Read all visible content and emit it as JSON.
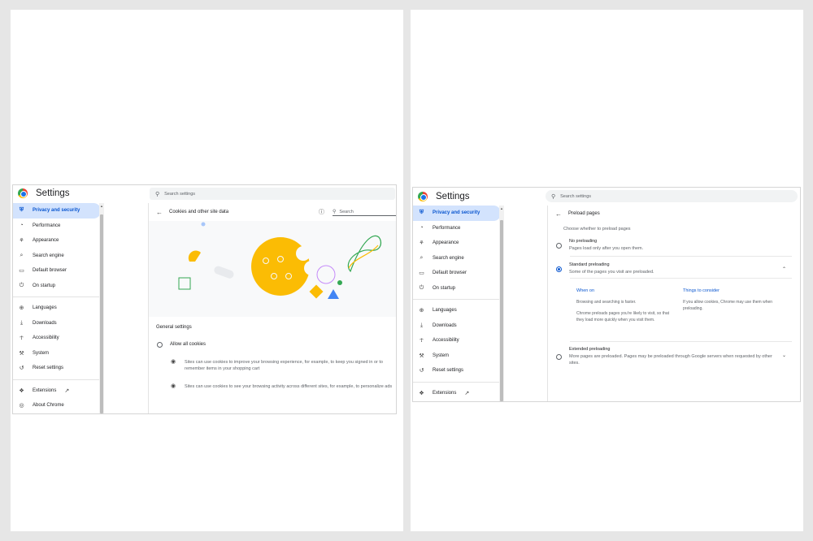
{
  "left": {
    "app_title": "Settings",
    "search_placeholder": "Search settings",
    "sidebar": [
      {
        "label": "Privacy and security",
        "icon": "shield-icon",
        "active": true
      },
      {
        "label": "Performance",
        "icon": "gauge-icon"
      },
      {
        "label": "Appearance",
        "icon": "palette-icon"
      },
      {
        "label": "Search engine",
        "icon": "search-icon"
      },
      {
        "label": "Default browser",
        "icon": "browser-icon"
      },
      {
        "label": "On startup",
        "icon": "power-icon"
      },
      {
        "label": "Languages",
        "icon": "globe-icon"
      },
      {
        "label": "Downloads",
        "icon": "download-icon"
      },
      {
        "label": "Accessibility",
        "icon": "accessibility-icon"
      },
      {
        "label": "System",
        "icon": "wrench-icon"
      },
      {
        "label": "Reset settings",
        "icon": "history-icon"
      },
      {
        "label": "Extensions",
        "icon": "puzzle-icon"
      },
      {
        "label": "About Chrome",
        "icon": "chrome-icon"
      }
    ],
    "page_title": "Cookies and other site data",
    "inner_search_placeholder": "Search",
    "general_settings": "General settings",
    "allow_all": "Allow all cookies",
    "bullet1": "Sites can use cookies to improve your browsing experience, for example, to keep you signed in or to remember items in your shopping cart",
    "bullet2": "Sites can use cookies to see your browsing activity across different sites, for example, to personalize ads",
    "colors": {
      "accent": "#0b57d0",
      "cookie": "#fbbc04",
      "green": "#34a853",
      "blue": "#4285f4"
    }
  },
  "right": {
    "app_title": "Settings",
    "search_placeholder": "Search settings",
    "sidebar": [
      {
        "label": "Privacy and security",
        "icon": "shield-icon",
        "active": true
      },
      {
        "label": "Performance",
        "icon": "gauge-icon"
      },
      {
        "label": "Appearance",
        "icon": "palette-icon"
      },
      {
        "label": "Search engine",
        "icon": "search-icon"
      },
      {
        "label": "Default browser",
        "icon": "browser-icon"
      },
      {
        "label": "On startup",
        "icon": "power-icon"
      },
      {
        "label": "Languages",
        "icon": "globe-icon"
      },
      {
        "label": "Downloads",
        "icon": "download-icon"
      },
      {
        "label": "Accessibility",
        "icon": "accessibility-icon"
      },
      {
        "label": "System",
        "icon": "wrench-icon"
      },
      {
        "label": "Reset settings",
        "icon": "history-icon"
      },
      {
        "label": "Extensions",
        "icon": "puzzle-icon"
      }
    ],
    "page_title": "Preload pages",
    "choose_label": "Choose whether to preload pages",
    "options": [
      {
        "title": "No preloading",
        "desc": "Pages load only after you open them.",
        "checked": false
      },
      {
        "title": "Standard preloading",
        "desc": "Some of the pages you visit are preloaded.",
        "checked": true
      },
      {
        "title": "Extended preloading",
        "desc": "More pages are preloaded. Pages may be preloaded through Google servers when requested by other sites.",
        "checked": false
      }
    ],
    "when_on_title": "When on",
    "when_on_1": "Browsing and searching is faster.",
    "when_on_2": "Chrome preloads pages you're likely to visit, so that they load more quickly when you visit them.",
    "consider_title": "Things to consider",
    "consider_1": "If you allow cookies, Chrome may use them when preloading."
  }
}
